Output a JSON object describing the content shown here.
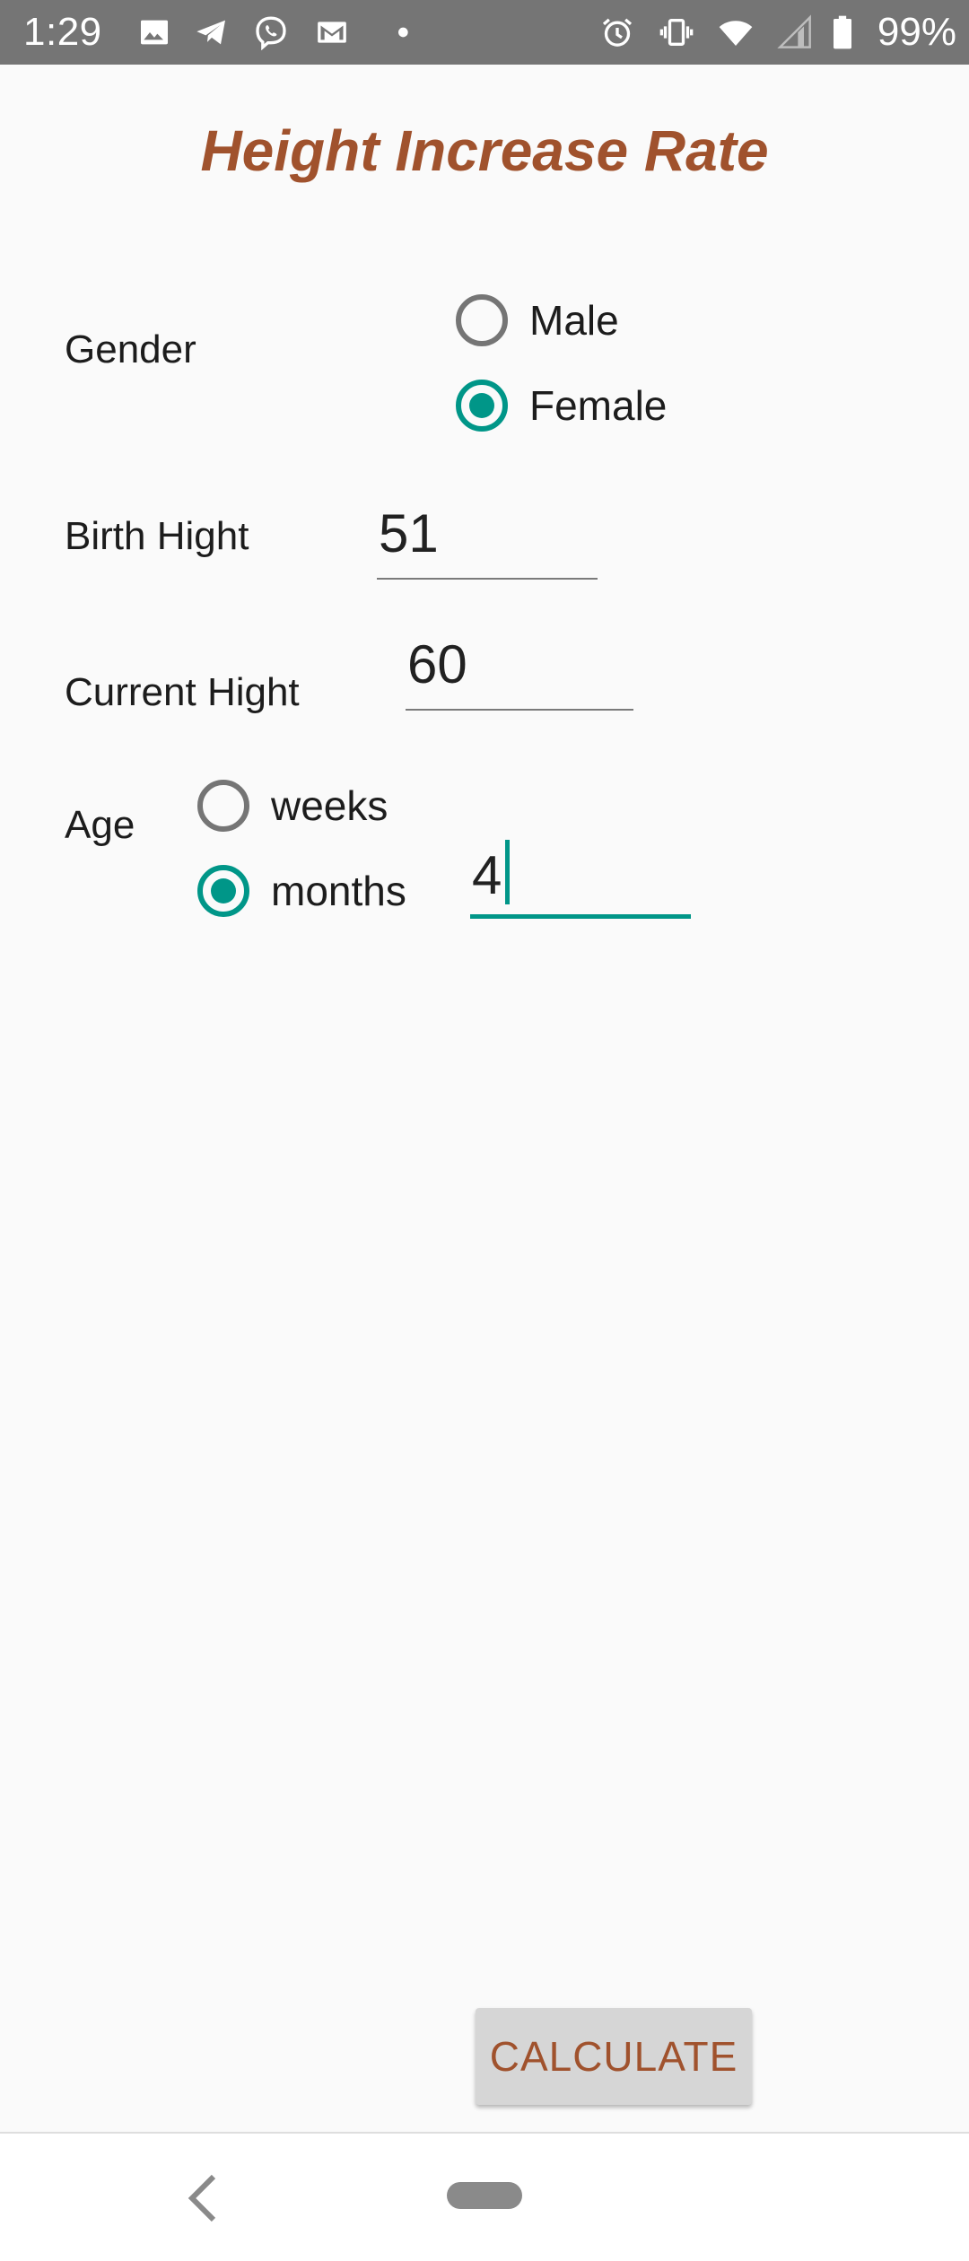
{
  "status_bar": {
    "time": "1:29",
    "battery_percent": "99%",
    "icons": [
      "image-icon",
      "telegram-icon",
      "viber-icon",
      "gmail-icon",
      "notification-dot-icon",
      "alarm-icon",
      "vibrate-icon",
      "wifi-icon",
      "signal-icon",
      "battery-icon"
    ]
  },
  "app": {
    "title": "Height Increase Rate"
  },
  "form": {
    "gender": {
      "label": "Gender",
      "options": [
        {
          "label": "Male",
          "checked": false
        },
        {
          "label": "Female",
          "checked": true
        }
      ]
    },
    "birth_height": {
      "label": "Birth Hight",
      "value": "51"
    },
    "current_height": {
      "label": "Current Hight",
      "value": "60"
    },
    "age": {
      "label": "Age",
      "options": [
        {
          "label": "weeks",
          "checked": false
        },
        {
          "label": "months",
          "checked": true
        }
      ],
      "value": "4"
    }
  },
  "actions": {
    "calculate_label": "CALCULATE"
  },
  "colors": {
    "accent": "#009688",
    "title": "#a0522d",
    "status_bar": "#757575"
  }
}
